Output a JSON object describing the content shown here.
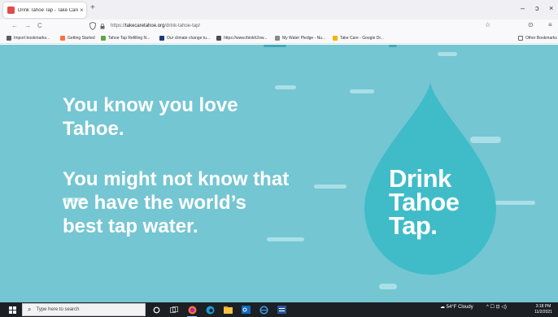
{
  "browser": {
    "tab": {
      "title": "Drink Tahoe Tap - Take Care",
      "close": "×"
    },
    "new_tab": "+",
    "window_controls": {
      "minimize": "–",
      "restore": "ɔ",
      "close": "×"
    },
    "nav": {
      "back": "←",
      "forward": "→",
      "reload": "C"
    },
    "url": {
      "scheme": "https://",
      "host": "takecaretahoe.org",
      "path": "/drink-tahoe-tap/"
    },
    "toolbar": {
      "star": "☆",
      "pocket": "⊙",
      "menu": "≡"
    },
    "bookmarks": [
      {
        "label": "Import bookmarks...",
        "color": "#5c5c66"
      },
      {
        "label": "Getting Started",
        "color": "#ff7139"
      },
      {
        "label": "Tahoe Tap Refilling N...",
        "color": "#5aa843"
      },
      {
        "label": "Our climate change tu...",
        "color": "#1b3e7a"
      },
      {
        "label": "https://www.thinkh2ow...",
        "color": "#4d4d57"
      },
      {
        "label": "My Water Pledge - Nu...",
        "color": "#8a8a8a"
      },
      {
        "label": "Take Care - Google Dr...",
        "color": "#f4b400"
      }
    ],
    "other_bookmarks": "Other Bookmarks"
  },
  "page": {
    "headline_1": [
      "You know you love",
      "Tahoe."
    ],
    "headline_2": [
      "You might not know that",
      "we have the world’s",
      "best tap water."
    ],
    "logo": [
      "Drink",
      "Tahoe",
      "Tap."
    ],
    "colors": {
      "background": "#74c6d2",
      "drop": "#40bcc9",
      "text": "#ffffff"
    }
  },
  "taskbar": {
    "search_placeholder": "Type here to search",
    "weather": "54°F Cloudy",
    "tray_icons": "^ ☐ ⊡ ◁)",
    "time": "3:18 PM",
    "date": "11/2/2021"
  }
}
